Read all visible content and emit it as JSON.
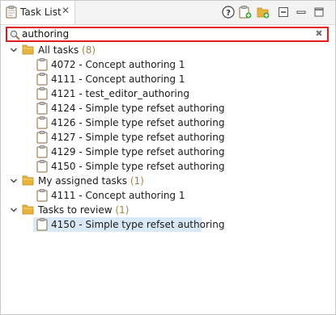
{
  "tab": {
    "title": "Task List",
    "close": "✕"
  },
  "toolbar": {
    "help_icon": "help-icon",
    "new_task_icon": "new-task-icon",
    "new_folder_icon": "new-folder-icon",
    "collapse_icon": "collapse-all-icon",
    "minimize_icon": "minimize-icon",
    "maximize_icon": "maximize-icon"
  },
  "search": {
    "value": "authoring",
    "clear": "✖"
  },
  "groups": [
    {
      "label": "All tasks",
      "count": "(8)",
      "expanded": true,
      "tasks": [
        "4072 - Concept authoring 1",
        "4111 - Concept authoring 1",
        "4121 - test_editor_authoring",
        "4124 - Simple type refset authoring",
        "4126 - Simple type refset authoring",
        "4127 - Simple type refset authoring",
        "4129 - Simple type refset authoring",
        "4150 - Simple type refset authoring"
      ]
    },
    {
      "label": "My assigned tasks",
      "count": "(1)",
      "expanded": true,
      "tasks": [
        "4111 - Concept authoring 1"
      ]
    },
    {
      "label": "Tasks to review",
      "count": "(1)",
      "expanded": true,
      "tasks": [
        "4150 - Simple type refset authoring"
      ]
    }
  ],
  "colors": {
    "search_border": "#e11b1b",
    "selection": "#d9e9f7",
    "folder": "#e8b43c",
    "count": "#a08346"
  }
}
